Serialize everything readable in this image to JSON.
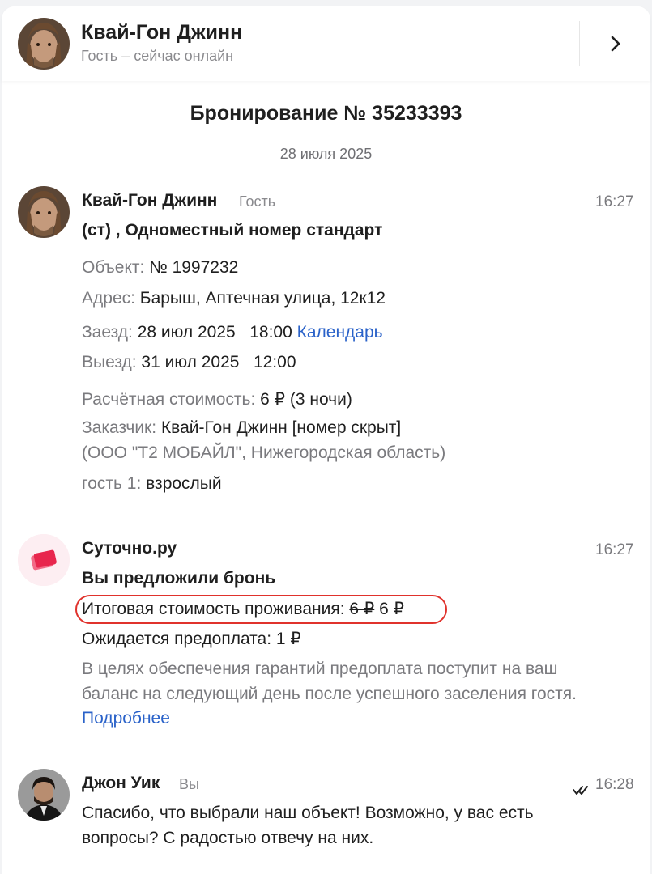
{
  "header": {
    "name": "Квай-Гон Джинн",
    "status": "Гость – сейчас онлайн",
    "chevron_icon": "chevron-right-icon"
  },
  "booking": {
    "title": "Бронирование № 35233393",
    "date": "28 июля 2025"
  },
  "messages": [
    {
      "sender": "Квай-Гон Джинн",
      "role": "Гость",
      "time": "16:27",
      "room": "(ст) , Одноместный номер стандарт",
      "object_label": "Объект:",
      "object_value": "№ 1997232",
      "address_label": "Адрес:",
      "address_value": "Барыш, Аптечная улица, 12к12",
      "checkin_label": "Заезд:",
      "checkin_value": "28 июл 2025   18:00",
      "calendar_link": "Календарь",
      "checkout_label": "Выезд:",
      "checkout_value": "31 июл 2025   12:00",
      "cost_label": "Расчётная стоимость:",
      "cost_value": "6 ₽ (3 ночи)",
      "customer_label": "Заказчик:",
      "customer_value": "Квай-Гон Джинн [номер скрыт]",
      "customer_org": "(ООО \"Т2 МОБАЙЛ\", Нижегородская область)",
      "guest_label": "гость 1:",
      "guest_value": "взрослый"
    },
    {
      "sender": "Суточно.ру",
      "time": "16:27",
      "offer": "Вы предложили бронь",
      "total_label": "Итоговая стоимость проживания:",
      "total_old": "6 ₽",
      "total_new": "6 ₽",
      "prepay": "Ожидается предоплата: 1 ₽",
      "note_line1": "В целях обеспечения гарантий предоплата поступит на ваш",
      "note_line2": "баланс на следующий день после успешного заселения гостя.",
      "more_link": "Подробнее"
    },
    {
      "sender": "Джон Уик",
      "role": "Вы",
      "time": "16:28",
      "read_icon": "double-check-icon",
      "text_line1": "Спасибо, что выбрали наш объект! Возможно, у вас есть",
      "text_line2": "вопросы? С радостью отвечу на них."
    }
  ],
  "colors": {
    "link": "#2a62c9",
    "highlight": "#e0322c",
    "brand": "#e8264d"
  }
}
